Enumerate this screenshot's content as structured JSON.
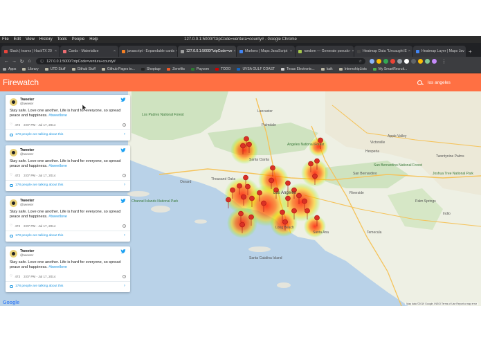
{
  "window": {
    "menus": [
      "File",
      "Edit",
      "View",
      "History",
      "Tools",
      "People",
      "Help"
    ],
    "title": "127.0.0.1:5000/?zipCode=ventura+county# - Google Chrome"
  },
  "tabs": [
    {
      "label": "Slack | teamx | HackTX 20",
      "color": "#e8453c"
    },
    {
      "label": "Cards - Materialize",
      "color": "#ee6e73"
    },
    {
      "label": "javascript - Expandable cards",
      "color": "#f48024"
    },
    {
      "label": "127.0.0.1:5000/?zipCode=ve",
      "color": "#9e9e9e"
    },
    {
      "label": "Markers  |  Maps JavaScript",
      "color": "#4285f4"
    },
    {
      "label": "random — Generate pseudo-",
      "color": "#a6c84c"
    },
    {
      "label": "Heatmap Data \"Uncaught E",
      "color": "#444444"
    },
    {
      "label": "Heatmap Layer  |  Maps Jav",
      "color": "#4285f4"
    }
  ],
  "toolbar": {
    "url": "127.0.0.1:5000/?zipCode=ventura+county#",
    "extension_colors": [
      "#8ab4f8",
      "#fbbc05",
      "#34a853",
      "#ea4335",
      "#9aa0a6",
      "#ffffff",
      "#5f6368",
      "#fbbc05",
      "#81c995"
    ]
  },
  "bookmarks": [
    "Apps",
    "Library",
    "UTD Stuff",
    "Github Stuff",
    "Github Pages to...",
    "Shoptagr",
    "Zenefits",
    "Paycom",
    "TODO",
    "UVSA GULF COAST",
    "Texas Electronic...",
    "kaik",
    "InternshipLists",
    "My SmartRecruit..."
  ],
  "app": {
    "brand": "Firewatch",
    "search_value": "los angeles"
  },
  "tweets": [
    {
      "name": "Tweeter",
      "handle": "@tweeter",
      "text": "Stay safe. Love one another. Life is hard for everyone, so spread peace and happiness. ",
      "hashtag": "#tweetlove",
      "likes": "472",
      "time": "3:07 PM - Jul 17, 2014",
      "talking": "178 people are talking about this"
    },
    {
      "name": "Tweeter",
      "handle": "@tweeter",
      "text": "Stay safe. Love one another. Life is hard for everyone, so spread peace and happiness. ",
      "hashtag": "#tweetlove",
      "likes": "472",
      "time": "3:07 PM - Jul 17, 2014",
      "talking": "178 people are talking about this"
    },
    {
      "name": "Tweeter",
      "handle": "@tweeter",
      "text": "Stay safe. Love one another. Life is hard for everyone, so spread peace and happiness. ",
      "hashtag": "#tweetlove",
      "likes": "472",
      "time": "3:07 PM - Jul 17, 2014",
      "talking": "178 people are talking about this"
    },
    {
      "name": "Tweeter",
      "handle": "@tweeter",
      "text": "Stay safe. Love one another. Life is hard for everyone, so spread peace and happiness. ",
      "hashtag": "#tweetlove",
      "likes": "472",
      "time": "3:07 PM - Jul 17, 2014",
      "talking": "178 people are talking about this"
    }
  ],
  "map": {
    "places": {
      "lancaster": "Lancaster",
      "palmdale": "Palmdale",
      "victorville": "Victorville",
      "apple_valley": "Apple Valley",
      "hesperia": "Hesperia",
      "los_padres": "Los Padres National Forest",
      "angeles": "Angeles National Forest",
      "oxnard": "Oxnard",
      "los_angeles": "Los Angeles",
      "san_bernardino": "San Bernardino",
      "riverside": "Riverside",
      "santa_ana": "Santa Ana",
      "long_beach": "Long Beach",
      "channel_islands": "Channel Islands National Park",
      "santa_catalina": "Santa Catalina Island",
      "san_bernardino_forest": "San Bernardino National Forest",
      "palm_springs": "Palm Springs",
      "indio": "Indio",
      "temecula": "Temecula",
      "joshua_tree": "Joshua Tree National Park",
      "thousand_oaks": "Thousand Oaks",
      "santa_clarita": "Santa Clarita",
      "twentynine_palms": "Twentynine Palms"
    },
    "attribution": "Map data ©2019 Google, INEGI   Terms of Use   Report a map error",
    "logo": "Google"
  }
}
